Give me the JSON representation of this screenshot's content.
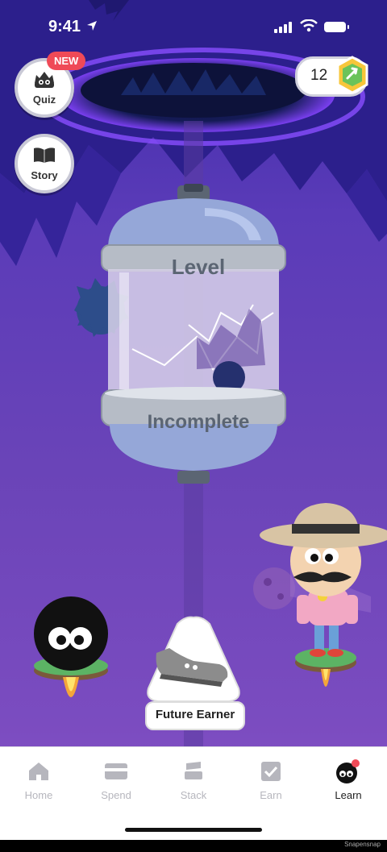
{
  "status_bar": {
    "time": "9:41"
  },
  "side_buttons": {
    "quiz_label": "Quiz",
    "new_badge": "NEW",
    "story_label": "Story"
  },
  "coins": {
    "count": "12"
  },
  "capsule": {
    "level_label": "Level",
    "status_label": "Incomplete"
  },
  "reward_card": {
    "label": "Future Earner"
  },
  "tabs": [
    {
      "label": "Home",
      "icon": "home-icon"
    },
    {
      "label": "Spend",
      "icon": "card-icon"
    },
    {
      "label": "Stack",
      "icon": "stack-icon"
    },
    {
      "label": "Earn",
      "icon": "checkbox-icon"
    },
    {
      "label": "Learn",
      "icon": "learn-icon"
    }
  ],
  "footer": {
    "watermark": "Snapensnap"
  },
  "colors": {
    "accent": "#ef4a57",
    "bg_top": "#3d2aa8",
    "bg_bottom": "#8a55c8"
  }
}
